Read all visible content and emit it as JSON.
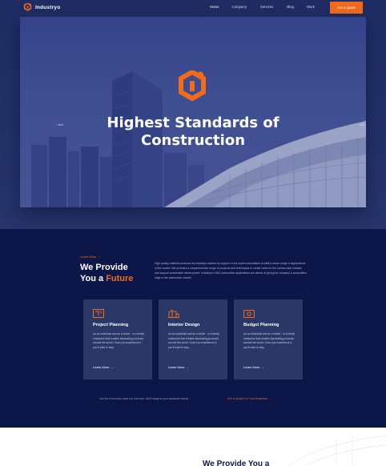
{
  "nav": {
    "brand": "Industryo",
    "items": [
      {
        "label": "Home",
        "active": true
      },
      {
        "label": "Company",
        "active": false
      },
      {
        "label": "Services",
        "active": false
      },
      {
        "label": "Blog",
        "active": false
      },
      {
        "label": "Work",
        "active": false
      }
    ],
    "cta": "Get a Quote"
  },
  "hero": {
    "title_line1": "Highest Standards of",
    "title_line2": "Construction",
    "prev": "‹ ###",
    "next": "### ›",
    "logo_icon": "industryo-logo-icon"
  },
  "services": {
    "eyebrow": "Learn More →",
    "title_line1": "We Provide",
    "title_line2_prefix": "You a ",
    "title_line2_accent": "Future",
    "description": "High quality material produced by Industryo backed by support of our expert consultants to fulfill a whole range of applications in the market. We provides a comprehensive range of products and techniques to create value for the construction industry and support sustainable development. Industryo's R&D automotive applications are aimed at giving the company a competitive edge in the automotive market.",
    "cards": [
      {
        "icon": "blueprint-icon",
        "title": "Project Planning",
        "text": "As an individual and as a whole - in a family enterprise that creates fascinating products around the world. Once you experience it, you'll want to stay.",
        "link": "Learn More →"
      },
      {
        "icon": "building-icon",
        "title": "Interior Design",
        "text": "As an individual and as a whole - in a family enterprise that creates fascinating products around the world. Once you experience it, you'll want to stay.",
        "link": "Learn More →"
      },
      {
        "icon": "budget-icon",
        "title": "Budget Planning",
        "text": "As an individual and as a whole - in a family enterprise that creates fascinating products around the world. Once you experience it, you'll want to stay.",
        "link": "Learn More →"
      }
    ],
    "footnote": "Our list of services does not end here. We'll adapt to your particular needs.",
    "footlink": "Get a Quote For Your Business →"
  },
  "next_section": {
    "title": "We Provide You a"
  },
  "colors": {
    "accent": "#f26b1d",
    "navy": "#0c1649",
    "card": "#2a3767",
    "hero": "#3b4a8c"
  }
}
